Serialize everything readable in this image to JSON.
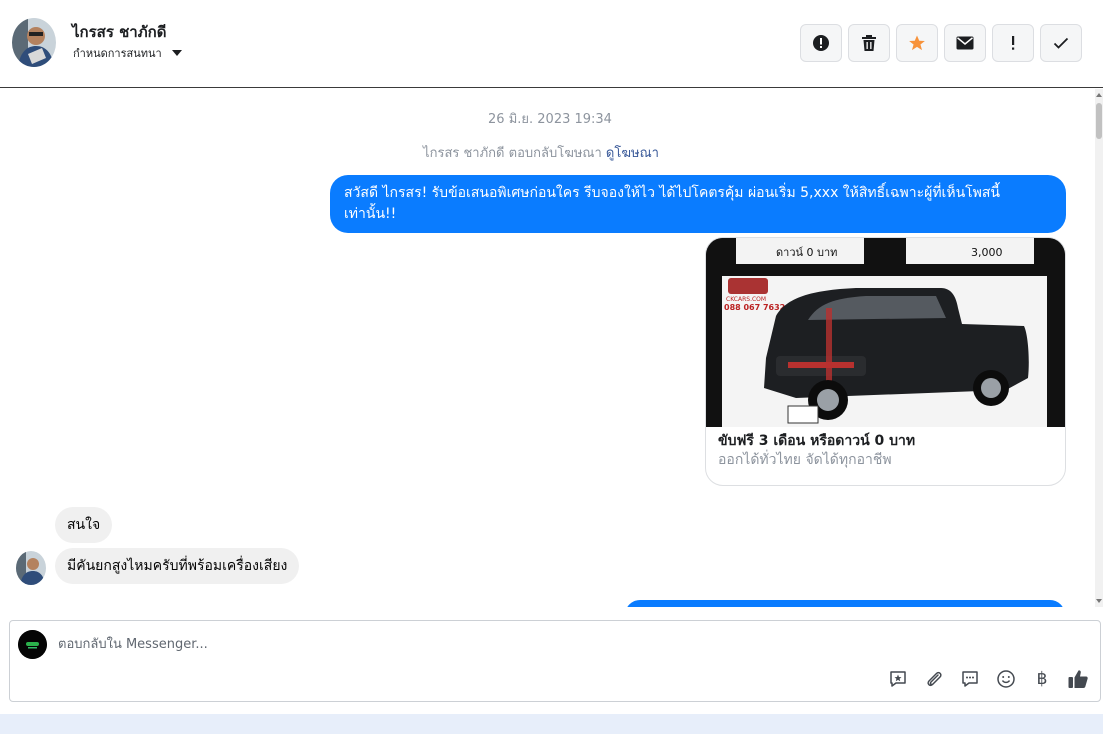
{
  "header": {
    "contact_name": "ไกรสร ชาภักดี",
    "assign_label": "กำหนดการสนทนา",
    "actions": [
      {
        "name": "spam-icon",
        "label": "!"
      },
      {
        "name": "trash-icon"
      },
      {
        "name": "star-icon",
        "color": "#f7923a"
      },
      {
        "name": "mail-icon"
      },
      {
        "name": "important-icon",
        "label": "!"
      },
      {
        "name": "check-icon"
      }
    ]
  },
  "conversation": {
    "timestamp": "26 มิ.ย. 2023 19:34",
    "ad_reply_prefix": "ไกรสร ชาภักดี ตอบกลับโฆษณา",
    "ad_reply_link": "ดูโฆษณา",
    "outgoing_message": "สวัสดี ไกรสร! รับข้อเสนอพิเศษก่อนใคร รีบจองให้ไว ได้ไปโคตรคุ้ม ผ่อนเริ่ม 5,xxx  ให้สิทธิ์เฉพาะผู้ที่เห็นโพสนี้เท่านั้น!!",
    "ad_card": {
      "image_banner_left": "ดาวน์ 0 บาท",
      "image_banner_right": "3,000",
      "image_logo_text": "CKCARS.COM",
      "image_phone": "088 067 7632",
      "title": "ขับฟรี 3 เดือน หรือดาวน์ 0 บาท",
      "subtitle": "ออกได้ทั่วไทย จัดได้ทุกอาชีพ"
    },
    "incoming_messages": [
      "สนใจ",
      "มีคันยกสูงไหมครับที่พร้อมเครื่องเสียง"
    ],
    "colors": {
      "outgoing": "#0a7cff",
      "incoming": "#f0f0f0"
    }
  },
  "composer": {
    "placeholder": "ตอบกลับใน Messenger...",
    "tools": [
      "saved-reply-icon",
      "attachment-icon",
      "chat-icon",
      "emoji-icon",
      "baht-icon",
      "like-icon"
    ],
    "baht_symbol": "฿"
  }
}
